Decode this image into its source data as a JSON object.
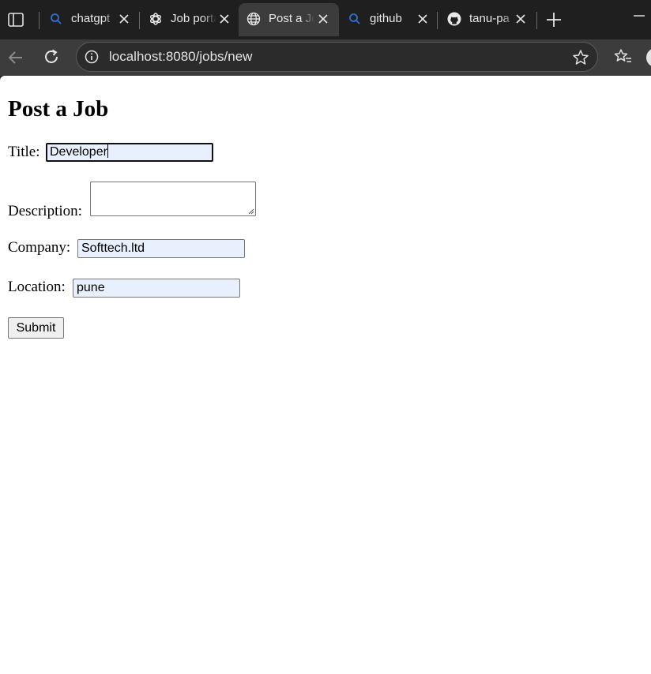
{
  "browser": {
    "tabs": [
      {
        "title": "chatgpt",
        "icon": "search-icon",
        "active": false
      },
      {
        "title": "Job portal",
        "icon": "openai-icon",
        "active": false
      },
      {
        "title": "Post a Job",
        "icon": "globe-icon",
        "active": true
      },
      {
        "title": "github",
        "icon": "search-icon",
        "active": false
      },
      {
        "title": "tanu-pa",
        "icon": "github-icon",
        "active": false
      }
    ],
    "url": "localhost:8080/jobs/new"
  },
  "page": {
    "heading": "Post a Job",
    "title_label": "Title:",
    "title_value": "Developer",
    "description_label": "Description:",
    "description_value": "",
    "company_label": "Company:",
    "company_value": "Softtech.ltd",
    "location_label": "Location:",
    "location_value": "pune",
    "submit_label": "Submit"
  },
  "colors": {
    "autofill_bg": "#e8f0fe",
    "tabbar_bg": "#1f1f1f",
    "toolbar_bg": "#3c3c3c"
  }
}
